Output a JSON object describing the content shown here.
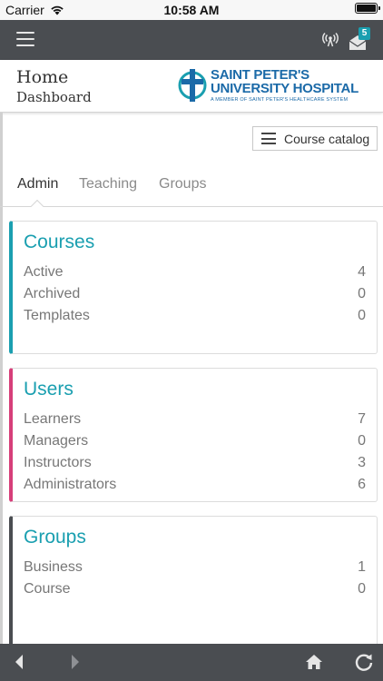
{
  "status_bar": {
    "carrier": "Carrier",
    "time": "10:58 AM"
  },
  "app_bar": {
    "mail_badge": "5"
  },
  "header": {
    "title": "Home",
    "subtitle": "Dashboard",
    "logo": {
      "line1": "SAINT PETER'S",
      "line2": "UNIVERSITY HOSPITAL",
      "line3": "A MEMBER OF SAINT PETER'S HEALTHCARE SYSTEM"
    }
  },
  "catalog_button": {
    "label": "Course catalog"
  },
  "tabs": [
    {
      "label": "Admin",
      "active": true
    },
    {
      "label": "Teaching",
      "active": false
    },
    {
      "label": "Groups",
      "active": false
    }
  ],
  "cards": {
    "courses": {
      "title": "Courses",
      "accent": "#1a9fb0",
      "rows": [
        {
          "label": "Active",
          "value": "4"
        },
        {
          "label": "Archived",
          "value": "0"
        },
        {
          "label": "Templates",
          "value": "0"
        }
      ]
    },
    "users": {
      "title": "Users",
      "accent": "#d63f7a",
      "rows": [
        {
          "label": "Learners",
          "value": "7"
        },
        {
          "label": "Managers",
          "value": "0"
        },
        {
          "label": "Instructors",
          "value": "3"
        },
        {
          "label": "Administrators",
          "value": "6"
        }
      ]
    },
    "groups": {
      "title": "Groups",
      "accent": "#4a4d51",
      "rows": [
        {
          "label": "Business",
          "value": "1"
        },
        {
          "label": "Course",
          "value": "0"
        }
      ]
    }
  },
  "icons": {
    "menu": "hamburger-icon",
    "signal": "broadcast-icon",
    "mail": "mail-icon",
    "catalog": "list-icon",
    "back": "back-arrow-icon",
    "forward": "forward-arrow-icon",
    "home": "home-icon",
    "refresh": "refresh-icon"
  },
  "colors": {
    "toolbar": "#4a4d51",
    "teal": "#1a9fb0",
    "pink": "#d63f7a",
    "logo_blue": "#1b6aa8"
  }
}
